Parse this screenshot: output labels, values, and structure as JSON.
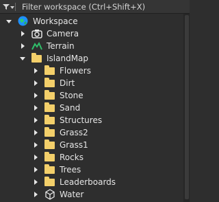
{
  "filter": {
    "placeholder": "Filter workspace (Ctrl+Shift+X)"
  },
  "tree": {
    "workspace": {
      "label": "Workspace"
    },
    "camera": {
      "label": "Camera"
    },
    "terrain": {
      "label": "Terrain"
    },
    "islandmap": {
      "label": "IslandMap"
    },
    "children": [
      {
        "label": "Flowers"
      },
      {
        "label": "Dirt"
      },
      {
        "label": "Stone"
      },
      {
        "label": "Sand"
      },
      {
        "label": "Structures"
      },
      {
        "label": "Grass2"
      },
      {
        "label": "Grass1"
      },
      {
        "label": "Rocks"
      },
      {
        "label": "Trees"
      },
      {
        "label": "Leaderboards"
      },
      {
        "label": "Water"
      }
    ]
  },
  "colors": {
    "background": "#2e2e2e",
    "folder": "#f3cf6a",
    "terrain": "#2fbf6a",
    "workspace": "#1e90ff"
  }
}
